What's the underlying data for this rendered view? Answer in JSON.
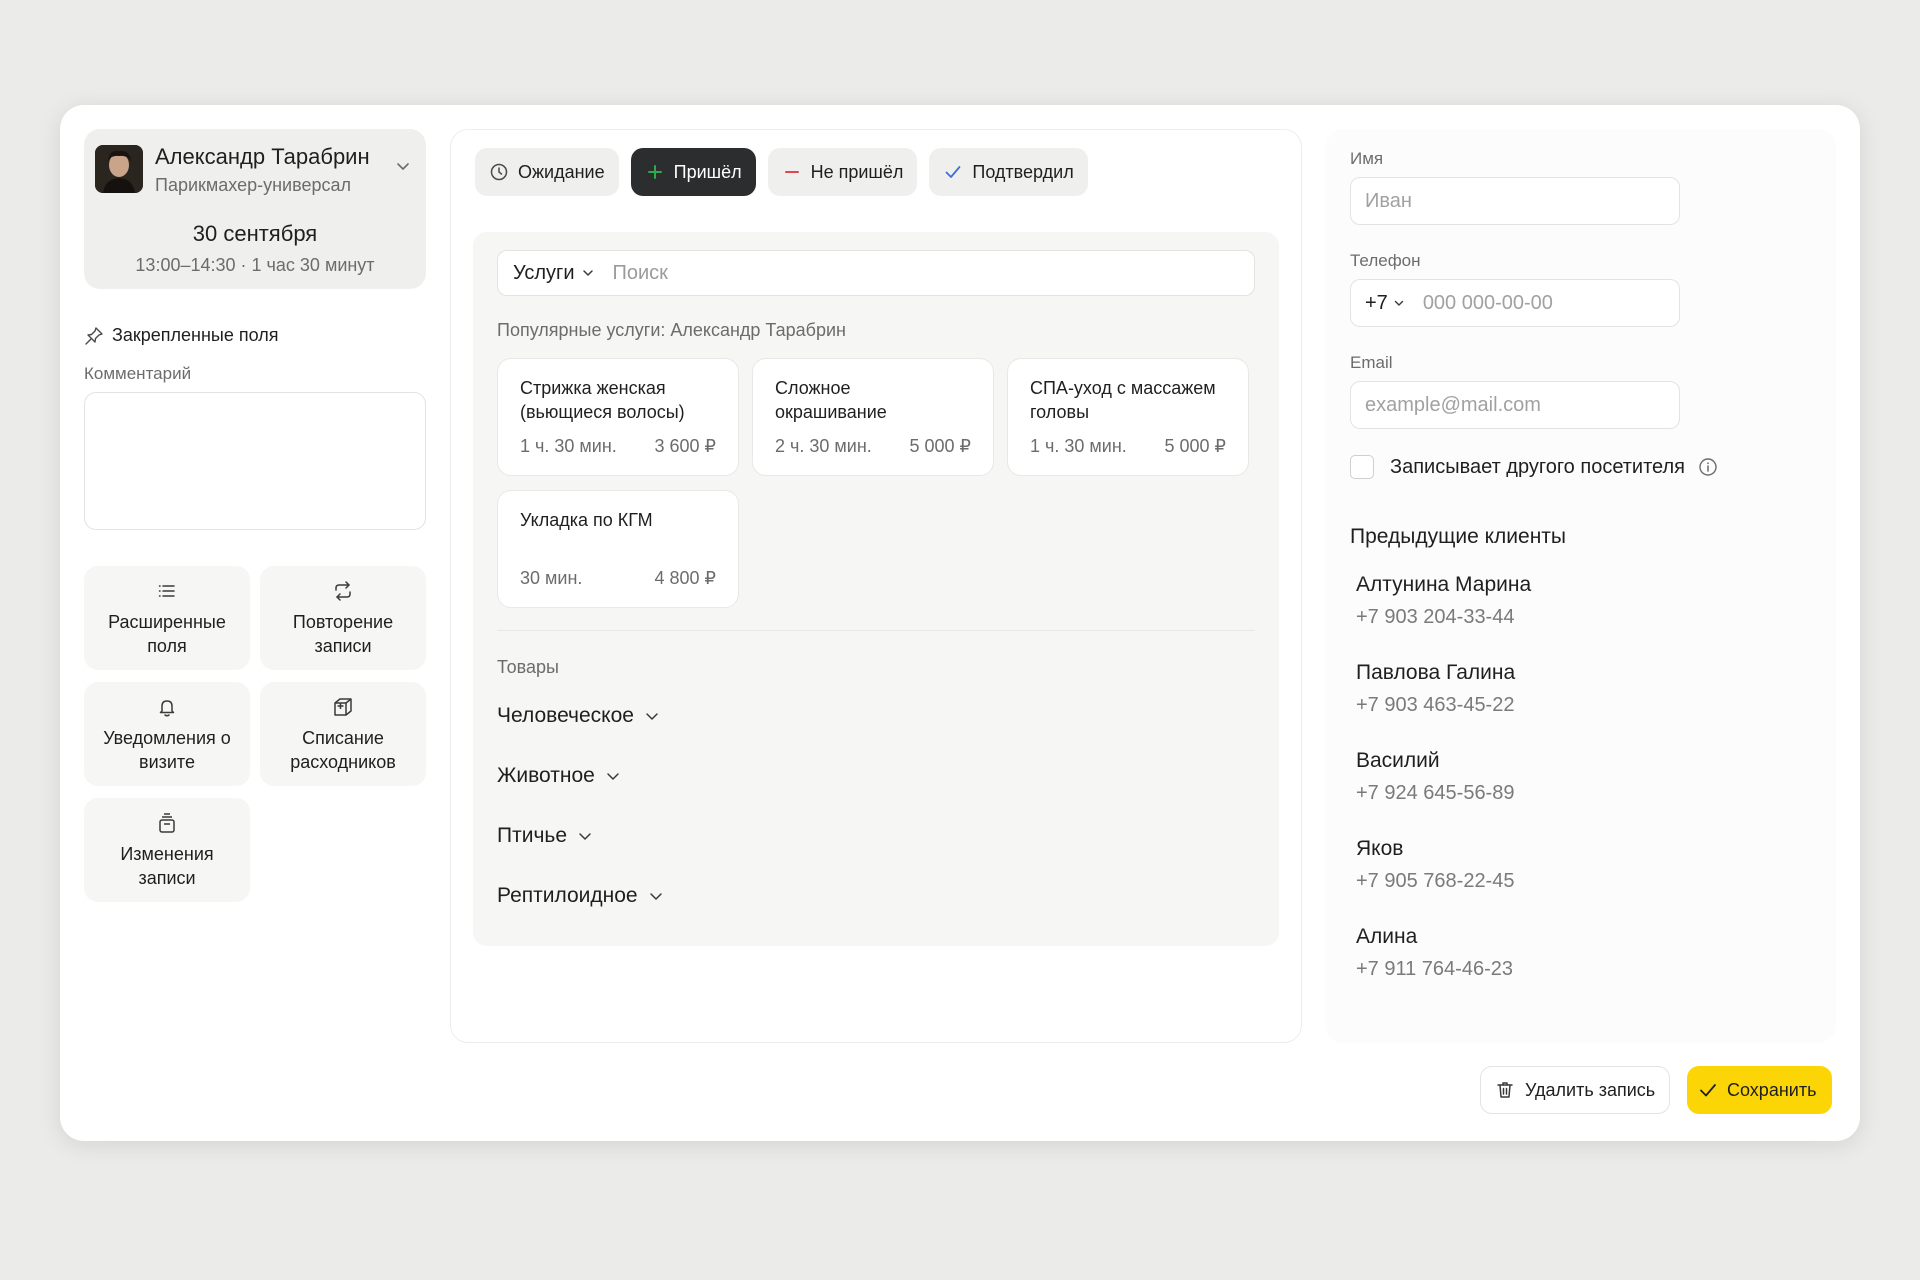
{
  "master": {
    "name": "Александр Тарабрин",
    "role": "Парикмахер-универсал",
    "date": "30 сентября",
    "time": "13:00–14:30 · 1 час 30 минут"
  },
  "sidebar": {
    "pinned_label": "Закрепленные поля",
    "comment_label": "Комментарий",
    "tiles": [
      {
        "label": "Расширенные поля",
        "icon": "list-icon"
      },
      {
        "label": "Повторение записи",
        "icon": "repeat-icon"
      },
      {
        "label": "Уведомления о визите",
        "icon": "bell-icon"
      },
      {
        "label": "Списание расходников",
        "icon": "box-icon"
      },
      {
        "label": "Изменения записи",
        "icon": "history-icon"
      }
    ]
  },
  "status": {
    "buttons": [
      {
        "label": "Ожидание",
        "icon": "clock-icon",
        "active": false
      },
      {
        "label": "Пришёл",
        "icon": "plus-icon",
        "active": true
      },
      {
        "label": "Не пришёл",
        "icon": "minus-icon",
        "active": false
      },
      {
        "label": "Подтвердил",
        "icon": "check-icon",
        "active": false
      }
    ]
  },
  "services": {
    "category": "Услуги",
    "search_placeholder": "Поиск",
    "popular_label": "Популярные услуги: Александр Тарабрин",
    "items": [
      {
        "name": "Стрижка женская (вьющиеся волосы)",
        "duration": "1 ч. 30 мин.",
        "price": "3 600 ₽"
      },
      {
        "name": "Сложное окрашивание",
        "duration": "2 ч. 30 мин.",
        "price": "5 000 ₽"
      },
      {
        "name": "СПА-уход с массажем головы",
        "duration": "1 ч. 30 мин.",
        "price": "5 000 ₽"
      },
      {
        "name": "Укладка по КГМ",
        "duration": "30 мин.",
        "price": "4 800 ₽"
      }
    ],
    "goods_label": "Товары",
    "goods_categories": [
      "Человеческое",
      "Животное",
      "Птичье",
      "Рептилоидное"
    ]
  },
  "client_form": {
    "name_label": "Имя",
    "name_placeholder": "Иван",
    "phone_label": "Телефон",
    "phone_code": "+7",
    "phone_placeholder": "000 000-00-00",
    "email_label": "Email",
    "email_placeholder": "example@mail.com",
    "other_visitor_label": "Записывает другого посетителя"
  },
  "previous_clients": {
    "title": "Предыдущие клиенты",
    "items": [
      {
        "name": "Алтунина Марина",
        "phone": "+7 903 204-33-44"
      },
      {
        "name": "Павлова Галина",
        "phone": "+7 903 463-45-22"
      },
      {
        "name": "Василий",
        "phone": "+7 924 645-56-89"
      },
      {
        "name": "Яков",
        "phone": "+7 905 768-22-45"
      },
      {
        "name": "Алина",
        "phone": "+7 911 764-46-23"
      }
    ]
  },
  "footer": {
    "delete_label": "Удалить запись",
    "save_label": "Сохранить"
  },
  "colors": {
    "accent": "#fcd507",
    "active_status": "#2b2d2f",
    "arrived_icon": "#2fa84f",
    "no_show_icon": "#e0474c",
    "confirmed_icon": "#3f6fd8"
  }
}
